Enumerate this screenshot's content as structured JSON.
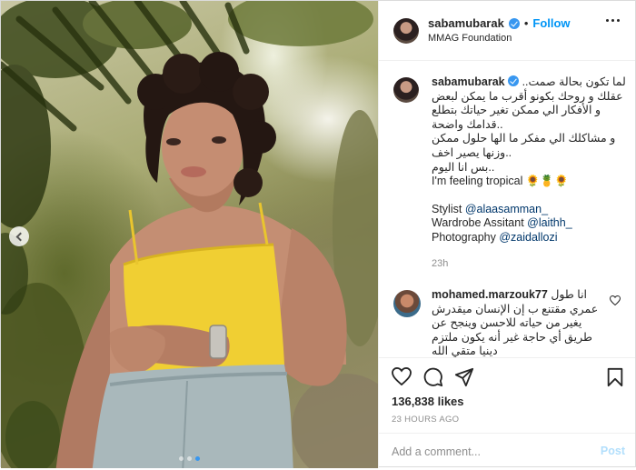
{
  "header": {
    "username": "sabamubarak",
    "follow_label": "Follow",
    "separator": "•",
    "location": "MMAG Foundation"
  },
  "caption": {
    "username": "sabamubarak",
    "lines": [
      "لما تكون بحالة صمت..",
      "عقلك و روحك بكونو أقرب ما يمكن لبعض",
      "و الأفكار الي ممكن تغير حياتك بتطلع",
      "..قدامك واضحة",
      "و مشاكلك الي مفكر ما الها حلول ممكن",
      "..وزنها يصير اخف",
      "..بس انا اليوم",
      "I'm feeling tropical 🌻🍍🌻"
    ],
    "credits": [
      {
        "prefix": "Stylist ",
        "tag": "@alaasamman_"
      },
      {
        "prefix": "Wardrobe Assitant ",
        "tag": "@laithh_"
      },
      {
        "prefix": "Photography ",
        "tag": "@zaidallozi"
      }
    ],
    "ago": "23h"
  },
  "comment": {
    "username": "mohamed.marzouk77",
    "first": "انا طول",
    "lines": [
      "عمري مقتنع ب إن الإنسان ميقدرش",
      "يغير من حياته للاحسن وينجح عن",
      "طريق أي حاجة غير أنه يكون ملتزم",
      "دينيا متقي الله"
    ]
  },
  "actions": {
    "likes": "136,838 likes",
    "time": "23 HOURS AGO"
  },
  "add_comment": {
    "placeholder": "Add a comment...",
    "post_label": "Post"
  },
  "icons": [
    "verified-badge-icon",
    "more-options-icon",
    "heart-icon",
    "comment-icon",
    "share-icon",
    "bookmark-icon",
    "chevron-left-icon"
  ],
  "colors": {
    "accent": "#0095f6",
    "post_disabled": "#b2dffc",
    "photo_top": "#dfe3c6",
    "top_yellow": "#f2d135"
  },
  "carousel": {
    "slides": 3,
    "active": 3
  }
}
